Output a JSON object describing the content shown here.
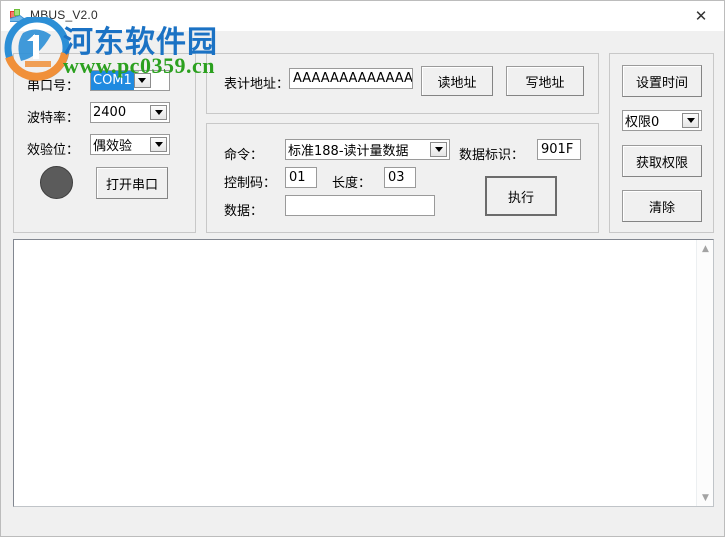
{
  "window": {
    "title": "MBUS_V2.0",
    "icon": "app-icon",
    "close_label": "✕"
  },
  "watermark": {
    "site_name": "河东软件园",
    "site_url": "www.pc0359.cn",
    "name_color": "#1b72c4",
    "url_color": "#2ba01f"
  },
  "serial_panel": {
    "port_label": "串口号：",
    "port_value": "COM1",
    "port_selected": true,
    "baud_label": "波特率：",
    "baud_value": "2400",
    "parity_label": "效验位：",
    "parity_value": "偶效验",
    "indicator_color": "#5b5b5b",
    "open_button": "打开串口"
  },
  "meter_panel": {
    "address_label": "表计地址：",
    "address_value": "AAAAAAAAAAAAAA",
    "read_button": "读地址",
    "write_button": "写地址"
  },
  "command_panel": {
    "command_label": "命令：",
    "command_value": "标准188-读计量数据",
    "data_id_label": "数据标识：",
    "data_id_value": "901F",
    "control_code_label": "控制码：",
    "control_code_value": "01",
    "length_label": "长度：",
    "length_value": "03",
    "data_label": "数据：",
    "data_value": "",
    "execute_button": "执行"
  },
  "right_panel": {
    "set_time_button": "设置时间",
    "permission_value": "权限0",
    "get_permission_button": "获取权限",
    "clear_button": "清除"
  },
  "log": {
    "text": ""
  },
  "scrollbar": {
    "up_arrow": "▲",
    "down_arrow": "▼"
  }
}
